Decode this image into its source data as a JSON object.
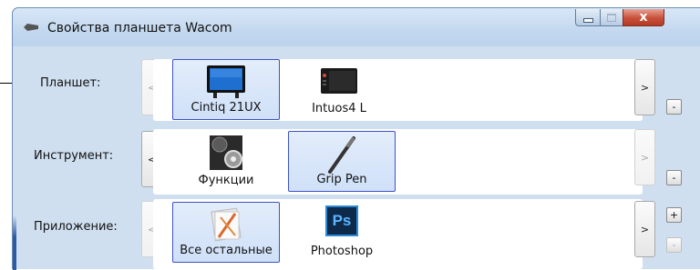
{
  "window": {
    "title": "Свойства планшета Wacom",
    "controls": {
      "minimize": "–",
      "maximize": "□",
      "close": "x"
    }
  },
  "rows": {
    "tablet": {
      "label": "Планшет:",
      "prev": "<",
      "next": ">",
      "remove": "-",
      "items": [
        {
          "label": "Cintiq 21UX",
          "icon": "display-tablet-icon",
          "selected": true
        },
        {
          "label": "Intuos4 L",
          "icon": "pen-tablet-icon",
          "selected": false
        }
      ]
    },
    "tool": {
      "label": "Инструмент:",
      "prev": "<",
      "next": ">",
      "remove": "-",
      "items": [
        {
          "label": "Функции",
          "icon": "functions-icon",
          "selected": false
        },
        {
          "label": "Grip Pen",
          "icon": "pen-icon",
          "selected": true
        }
      ]
    },
    "application": {
      "label": "Приложение:",
      "prev": "<",
      "next": ">",
      "add": "+",
      "remove": "-",
      "items": [
        {
          "label": "Все остальные",
          "icon": "all-apps-icon",
          "selected": true
        },
        {
          "label": "Photoshop",
          "icon": "photoshop-icon",
          "icon_text": "Ps",
          "selected": false
        }
      ]
    }
  },
  "colors": {
    "selection_border": "#3d52c5",
    "window_bg": "#cfdff0",
    "close_button": "#c7503a"
  }
}
